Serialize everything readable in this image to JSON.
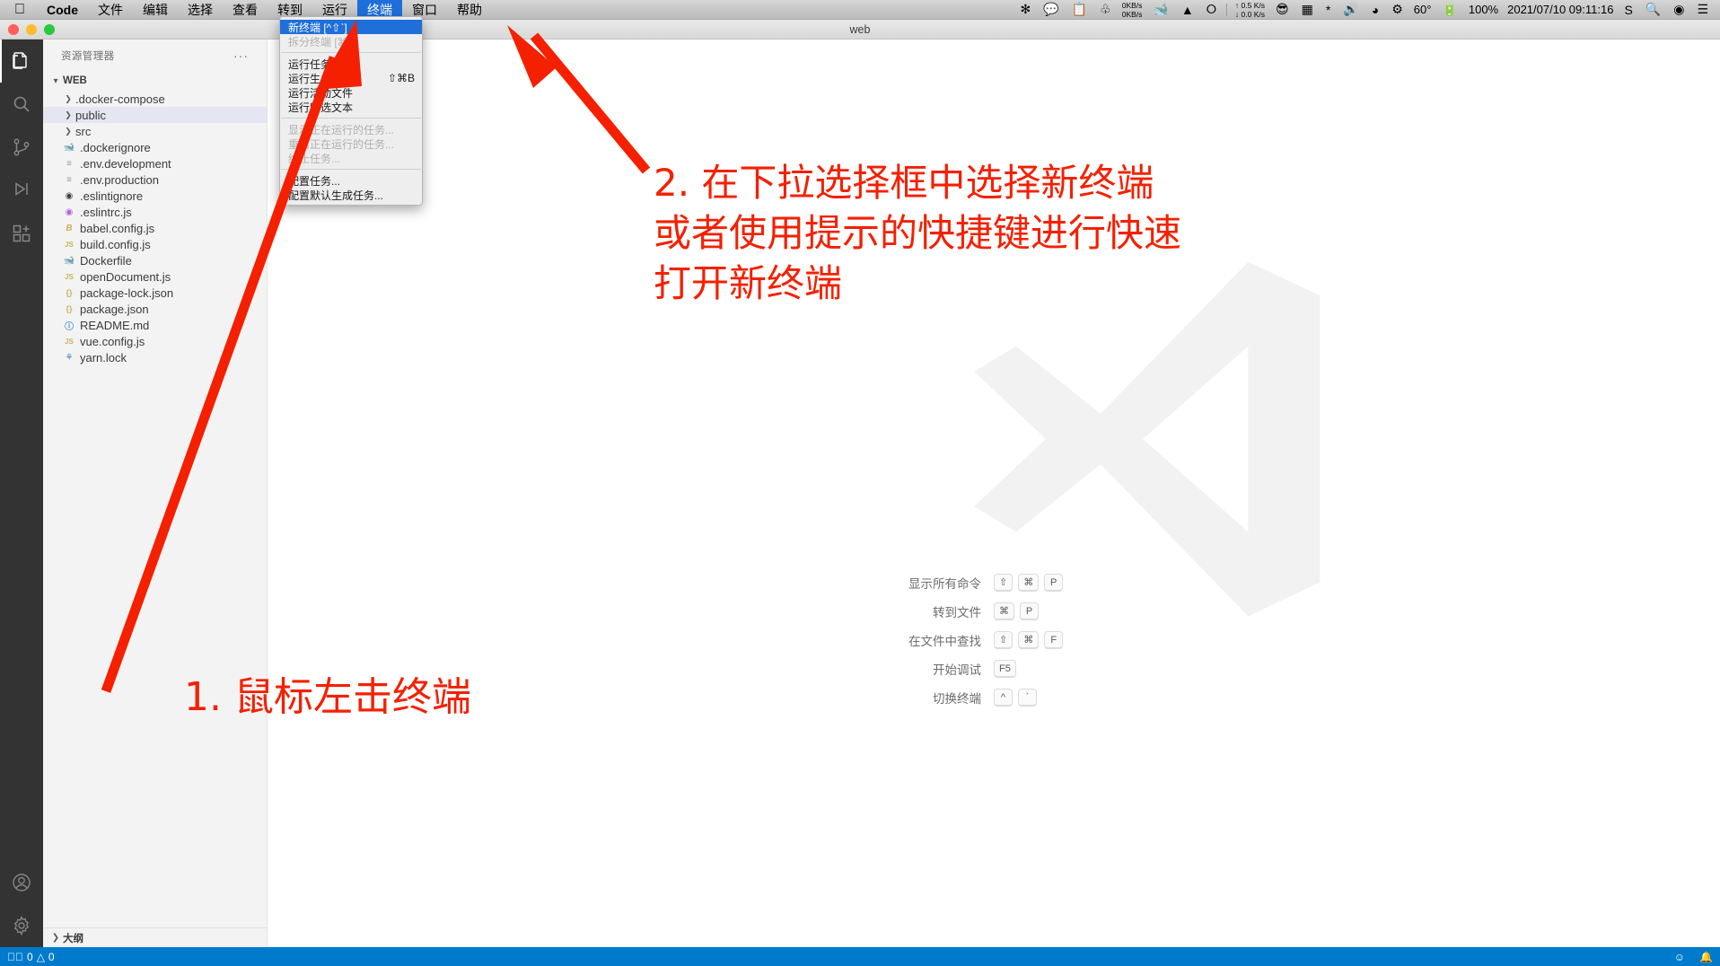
{
  "macbar": {
    "apple_icon": "apple-logo",
    "menus": [
      {
        "label": "Code",
        "bold": true,
        "active": false
      },
      {
        "label": "文件",
        "bold": false,
        "active": false
      },
      {
        "label": "编辑",
        "bold": false,
        "active": false
      },
      {
        "label": "选择",
        "bold": false,
        "active": false
      },
      {
        "label": "查看",
        "bold": false,
        "active": false
      },
      {
        "label": "转到",
        "bold": false,
        "active": false
      },
      {
        "label": "运行",
        "bold": false,
        "active": false
      },
      {
        "label": "终端",
        "bold": false,
        "active": true
      },
      {
        "label": "窗口",
        "bold": false,
        "active": false
      },
      {
        "label": "帮助",
        "bold": false,
        "active": false
      }
    ],
    "tray": {
      "icons": [
        "asterisk-icon",
        "wechat-icon",
        "clipboard-icon",
        "battery-monitor-icon"
      ],
      "net_up": "0KB/s",
      "net_down": "0KB/s",
      "docker_icon": "docker-whale-icon",
      "qq_icon": "qq-penguin-icon",
      "shadow_icon": "shadowsocks-icon",
      "speed_up": "↑ 0.5 K/s",
      "speed_down": "↓ 0.0 K/s",
      "more_icons": [
        "smiley-icon",
        "window-icon",
        "bluetooth-icon",
        "volume-icon",
        "wifi-icon",
        "gear-icon"
      ],
      "temperature": "60°",
      "battery_icon": "battery-icon",
      "battery_percent": "100%",
      "datetime": "2021/07/10 09:11:16",
      "sogou_icon": "sogou-input-icon",
      "search_icon": "spotlight-search-icon",
      "siri_icon": "siri-icon",
      "control_center_icon": "control-center-icon"
    }
  },
  "window": {
    "title": "web",
    "traffic_lights": [
      "close-button",
      "minimize-button",
      "maximize-button"
    ]
  },
  "activitybar": {
    "items": [
      {
        "name": "explorer",
        "icon": "files-icon",
        "selected": true
      },
      {
        "name": "search",
        "icon": "search-icon",
        "selected": false
      },
      {
        "name": "source-control",
        "icon": "source-control-icon",
        "selected": false
      },
      {
        "name": "run-debug",
        "icon": "run-debug-icon",
        "selected": false
      },
      {
        "name": "extensions",
        "icon": "extensions-icon",
        "selected": false
      }
    ],
    "bottom": [
      {
        "name": "accounts",
        "icon": "account-icon"
      },
      {
        "name": "settings",
        "icon": "gear-icon"
      }
    ]
  },
  "sidebar": {
    "title": "资源管理器",
    "more_actions": "···",
    "root": {
      "label": "WEB",
      "expanded": true
    },
    "tree": [
      {
        "label": ".docker-compose",
        "type": "folder",
        "expanded": false,
        "selected": false,
        "icon": "chevron-right-icon"
      },
      {
        "label": "public",
        "type": "folder",
        "expanded": false,
        "selected": true,
        "icon": "chevron-right-icon"
      },
      {
        "label": "src",
        "type": "folder",
        "expanded": false,
        "selected": false,
        "icon": "chevron-right-icon"
      },
      {
        "label": ".dockerignore",
        "type": "file",
        "icon": "docker-icon",
        "color": "#3a82c4"
      },
      {
        "label": ".env.development",
        "type": "file",
        "icon": "settings-lines-icon",
        "color": "#9a9a9a"
      },
      {
        "label": ".env.production",
        "type": "file",
        "icon": "settings-lines-icon",
        "color": "#9a9a9a"
      },
      {
        "label": ".eslintignore",
        "type": "file",
        "icon": "eslint-icon",
        "color": "#3c3c3c"
      },
      {
        "label": ".eslintrc.js",
        "type": "file",
        "icon": "eslint-icon",
        "color": "#b45fd8"
      },
      {
        "label": "babel.config.js",
        "type": "file",
        "icon": "babel-icon",
        "color": "#c9b458"
      },
      {
        "label": "build.config.js",
        "type": "file",
        "icon": "js-icon",
        "color": "#c9b458"
      },
      {
        "label": "Dockerfile",
        "type": "file",
        "icon": "docker-icon",
        "color": "#3a82c4"
      },
      {
        "label": "openDocument.js",
        "type": "file",
        "icon": "js-icon",
        "color": "#c9b458"
      },
      {
        "label": "package-lock.json",
        "type": "file",
        "icon": "json-icon",
        "color": "#c9b458"
      },
      {
        "label": "package.json",
        "type": "file",
        "icon": "json-icon",
        "color": "#c9b458"
      },
      {
        "label": "README.md",
        "type": "file",
        "icon": "info-icon",
        "color": "#4b8fd0"
      },
      {
        "label": "vue.config.js",
        "type": "file",
        "icon": "js-icon",
        "color": "#c9b458"
      },
      {
        "label": "yarn.lock",
        "type": "file",
        "icon": "yarn-icon",
        "color": "#3a82c4"
      }
    ],
    "outline": {
      "label": "大纲",
      "expanded": false
    }
  },
  "menu_dropdown": {
    "groups": [
      [
        {
          "label": "新终端 [^⇧`]",
          "highlighted": true,
          "disabled": false,
          "shortcut": ""
        },
        {
          "label": "拆分终端 [⌘\\]",
          "highlighted": false,
          "disabled": true,
          "shortcut": ""
        }
      ],
      [
        {
          "label": "运行任务...",
          "highlighted": false,
          "disabled": false,
          "shortcut": ""
        },
        {
          "label": "运行生成任务...",
          "highlighted": false,
          "disabled": false,
          "shortcut": "⇧⌘B"
        },
        {
          "label": "运行活动文件",
          "highlighted": false,
          "disabled": false,
          "shortcut": ""
        },
        {
          "label": "运行所选文本",
          "highlighted": false,
          "disabled": false,
          "shortcut": ""
        }
      ],
      [
        {
          "label": "显示正在运行的任务...",
          "highlighted": false,
          "disabled": true,
          "shortcut": ""
        },
        {
          "label": "重启正在运行的任务...",
          "highlighted": false,
          "disabled": true,
          "shortcut": ""
        },
        {
          "label": "终止任务...",
          "highlighted": false,
          "disabled": true,
          "shortcut": ""
        }
      ],
      [
        {
          "label": "配置任务...",
          "highlighted": false,
          "disabled": false,
          "shortcut": ""
        },
        {
          "label": "配置默认生成任务...",
          "highlighted": false,
          "disabled": false,
          "shortcut": ""
        }
      ]
    ]
  },
  "editor": {
    "watermark_icon": "vscode-logo-watermark",
    "shortcuts": [
      {
        "label": "显示所有命令",
        "keys": [
          "⇧",
          "⌘",
          "P"
        ]
      },
      {
        "label": "转到文件",
        "keys": [
          "⌘",
          "P"
        ]
      },
      {
        "label": "在文件中查找",
        "keys": [
          "⇧",
          "⌘",
          "F"
        ]
      },
      {
        "label": "开始调试",
        "keys": [
          "F5"
        ]
      },
      {
        "label": "切换终端",
        "keys": [
          "^",
          "`"
        ]
      }
    ]
  },
  "statusbar": {
    "errors": "0",
    "warnings": "0",
    "error_icon": "error-circle-icon",
    "warning_icon": "warning-triangle-icon",
    "right_icons": [
      "bell-icon",
      "feedback-icon"
    ]
  },
  "annotations": [
    {
      "id": "anno1",
      "text": "1. 鼠标左击终端",
      "color": "#f42000"
    },
    {
      "id": "anno2",
      "text": "2. 在下拉选择框中选择新终端\n或者使用提示的快捷键进行快速\n打开新终端",
      "color": "#f42000"
    }
  ],
  "colors": {
    "accent": "#007acc",
    "menu_highlight": "#1e6fd9",
    "annotation": "#f42000",
    "activitybar_bg": "#333333",
    "sidebar_bg": "#f3f3f3"
  }
}
